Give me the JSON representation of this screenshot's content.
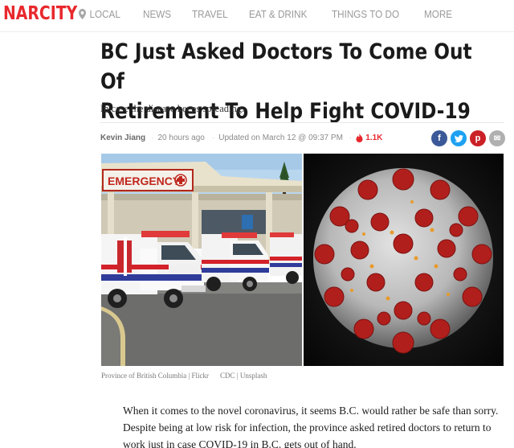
{
  "nav": {
    "logo": "NARCITY",
    "items": [
      {
        "label": "LOCAL",
        "icon": "location-pin-icon"
      },
      {
        "label": "NEWS"
      },
      {
        "label": "TRAVEL"
      },
      {
        "label": "EAT & DRINK"
      },
      {
        "label": "THINGS TO DO"
      },
      {
        "label": "MORE"
      }
    ]
  },
  "article": {
    "title_line1": "BC Just Asked Doctors To Come Out Of",
    "title_line2": "Retirement To Help Fight COVID-19",
    "subtitle": "In case the disease keeps spreading.",
    "author": "Kevin Jiang",
    "time": "20 hours ago",
    "updated": "Updated on March 12 @ 09:37 PM",
    "views": "1.1K",
    "share": {
      "facebook": "f",
      "twitter": "t",
      "pinterest": "p",
      "email": "✉"
    },
    "images": {
      "left_sign": "EMERGENCY",
      "left_caption": "Province of British Columbia | Flickr",
      "right_caption": "CDC | Unsplash"
    },
    "body_part1": "When it comes to the novel coronavirus, it seems B.C. would rather be safe than sorry. Despite being at low risk for infection, the province asked retired doctors to return to work just in case ",
    "body_link": "COVID-19 in B.C.",
    "body_part2": " gets out of hand."
  },
  "colors": {
    "brand": "#e8282d",
    "facebook": "#3b5998",
    "twitter": "#1da1f2",
    "pinterest": "#cb2027"
  }
}
